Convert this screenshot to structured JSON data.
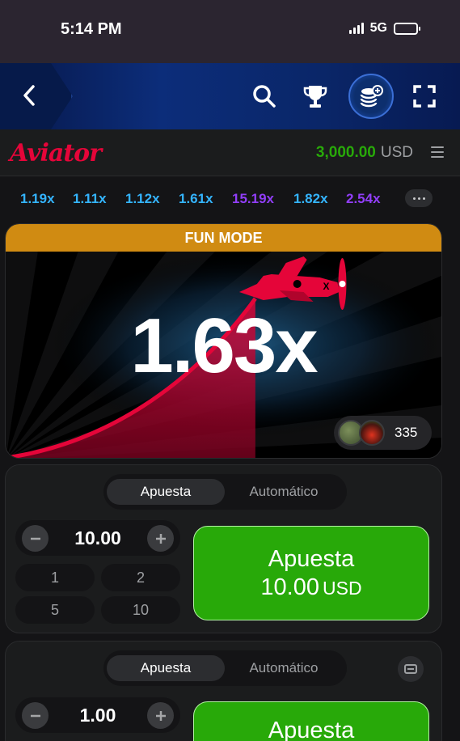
{
  "status_bar": {
    "time": "5:14 PM",
    "network": "5G",
    "battery_level": 1.0
  },
  "nav": {
    "icons": [
      "back-icon",
      "search-icon",
      "trophy-icon",
      "coins-add-icon",
      "fullscreen-icon"
    ]
  },
  "header": {
    "logo": "Aviator",
    "balance_amount": "3,000.00",
    "balance_currency": "USD"
  },
  "history": {
    "items": [
      {
        "value": "1.19x",
        "color": "#34b4ff"
      },
      {
        "value": "1.11x",
        "color": "#34b4ff"
      },
      {
        "value": "1.12x",
        "color": "#34b4ff"
      },
      {
        "value": "1.61x",
        "color": "#34b4ff"
      },
      {
        "value": "15.19x",
        "color": "#913ef8"
      },
      {
        "value": "1.82x",
        "color": "#34b4ff"
      },
      {
        "value": "2.54x",
        "color": "#913ef8"
      }
    ]
  },
  "game": {
    "banner": "FUN MODE",
    "multiplier": "1.63x",
    "players_count": "335"
  },
  "bet_panels": [
    {
      "tab_active": "Apuesta",
      "tab_inactive": "Automático",
      "stake": "10.00",
      "quick_amounts": [
        "1",
        "2",
        "5",
        "10"
      ],
      "button_label": "Apuesta",
      "button_amount": "10.00",
      "button_currency": "USD"
    },
    {
      "tab_active": "Apuesta",
      "tab_inactive": "Automático",
      "stake": "1.00",
      "button_label": "Apuesta"
    }
  ],
  "colors": {
    "accent_red": "#e50539",
    "bet_green": "#28a909",
    "fun_mode_orange": "#d08b12"
  }
}
